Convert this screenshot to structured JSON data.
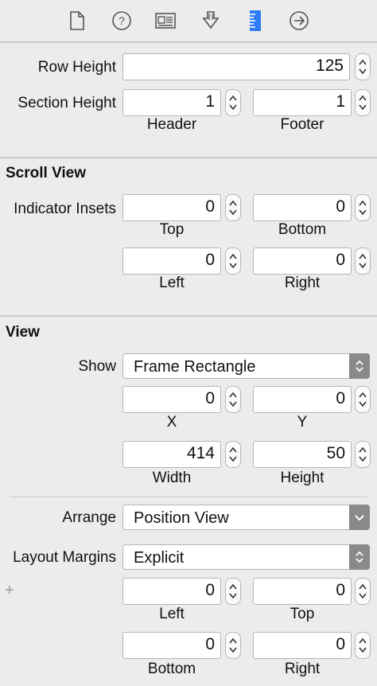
{
  "toolbar": {
    "icons": [
      "file-inspector-icon",
      "quick-help-icon",
      "identity-inspector-icon",
      "attributes-inspector-icon",
      "size-inspector-icon",
      "connections-inspector-icon"
    ],
    "active_color": "#2f7cf6",
    "icon_color": "#555555"
  },
  "table": {
    "row_height_label": "Row Height",
    "row_height_value": "125",
    "section_height_label": "Section Height",
    "header_value": "1",
    "footer_value": "1",
    "header_label": "Header",
    "footer_label": "Footer"
  },
  "scroll_view": {
    "title": "Scroll View",
    "indicator_insets_label": "Indicator Insets",
    "top_value": "0",
    "bottom_value": "0",
    "left_value": "0",
    "right_value": "0",
    "top_label": "Top",
    "bottom_label": "Bottom",
    "left_label": "Left",
    "right_label": "Right"
  },
  "view": {
    "title": "View",
    "show_label": "Show",
    "show_value": "Frame Rectangle",
    "x_value": "0",
    "y_value": "0",
    "x_label": "X",
    "y_label": "Y",
    "width_value": "414",
    "height_value": "50",
    "width_label": "Width",
    "height_label": "Height",
    "arrange_label": "Arrange",
    "arrange_value": "Position View",
    "layout_margins_label": "Layout Margins",
    "layout_margins_value": "Explicit",
    "add_symbol": "+",
    "margin_left_value": "0",
    "margin_top_value": "0",
    "margin_bottom_value": "0",
    "margin_right_value": "0",
    "margin_left_label": "Left",
    "margin_top_label": "Top",
    "margin_bottom_label": "Bottom",
    "margin_right_label": "Right"
  }
}
